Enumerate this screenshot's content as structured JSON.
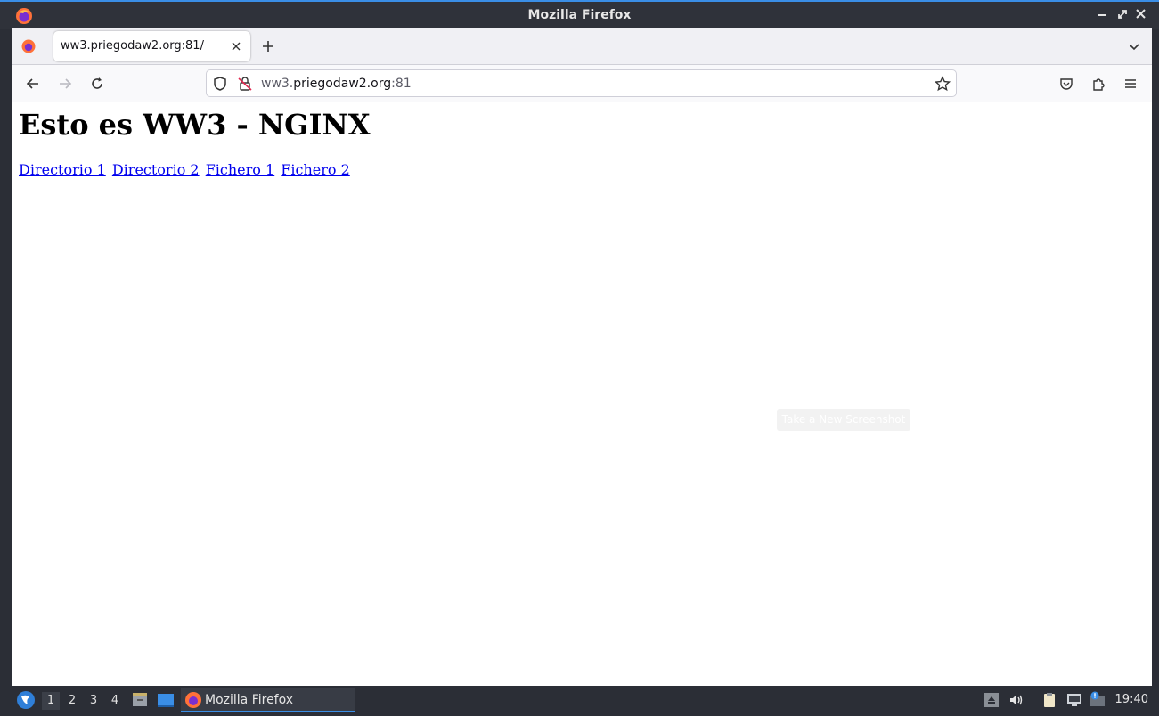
{
  "window": {
    "title": "Mozilla Firefox"
  },
  "tabs": [
    {
      "label": "ww3.priegodaw2.org:81/"
    }
  ],
  "urlbar": {
    "prefix": "ww3.",
    "domain": "priegodaw2.org",
    "port": ":81"
  },
  "page": {
    "heading": "Esto es WW3 - NGINX",
    "links": [
      {
        "label": "Directorio 1"
      },
      {
        "label": "Directorio 2"
      },
      {
        "label": "Fichero 1"
      },
      {
        "label": "Fichero 2"
      }
    ],
    "tooltip": "Take a New Screenshot"
  },
  "taskbar": {
    "workspaces": [
      "1",
      "2",
      "3",
      "4"
    ],
    "active_workspace": "1",
    "task_label": "Mozilla Firefox",
    "clock": "19:40"
  },
  "colors": {
    "accent": "#3a8ee6",
    "link": "#0000ee",
    "panel": "#2b2e36"
  }
}
